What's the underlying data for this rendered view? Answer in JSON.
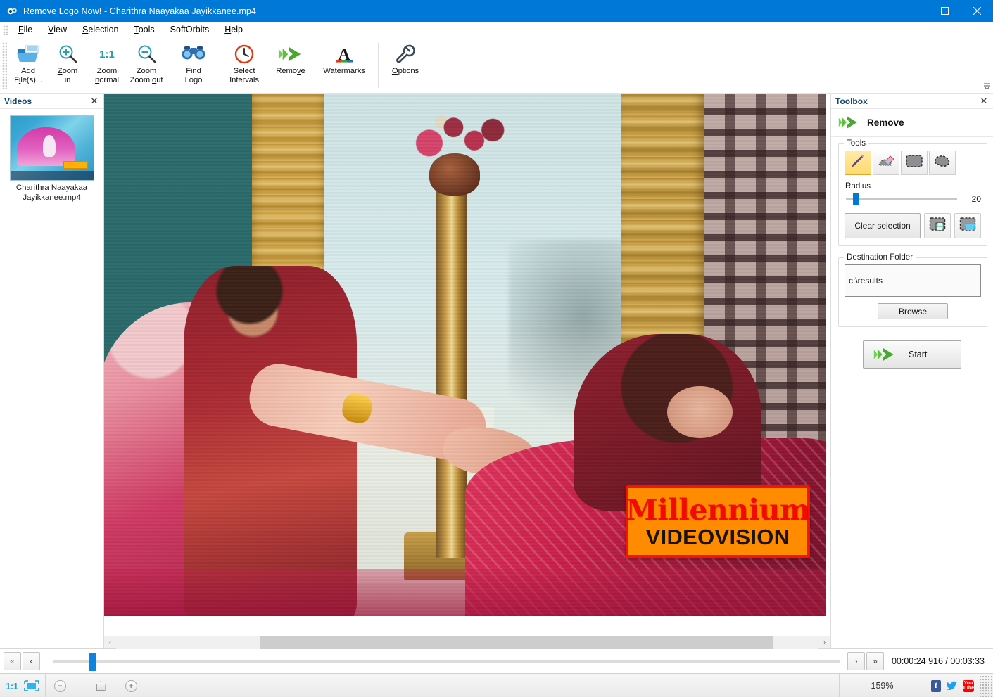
{
  "window": {
    "title": "Remove Logo Now! - Charithra Naayakaa Jayikkanee.mp4",
    "app_icon": "app-logo-icon",
    "minimize": "—",
    "maximize": "☐",
    "close": "✕"
  },
  "menubar": {
    "items": [
      {
        "label": "File",
        "accel": "F"
      },
      {
        "label": "View",
        "accel": "V"
      },
      {
        "label": "Selection",
        "accel": "S"
      },
      {
        "label": "Tools",
        "accel": "T"
      },
      {
        "label": "SoftOrbits",
        "accel": ""
      },
      {
        "label": "Help",
        "accel": "H"
      }
    ]
  },
  "ribbon": {
    "buttons": [
      {
        "name": "add-files",
        "line1": "Add",
        "line2": "File(s)...",
        "icon": "folder-open-icon"
      },
      {
        "name": "zoom-in",
        "line1": "Zoom",
        "line2": "in",
        "icon": "zoom-in-icon"
      },
      {
        "name": "zoom-normal",
        "line1": "Zoom",
        "line2": "normal",
        "icon": "one-to-one-icon"
      },
      {
        "name": "zoom-out",
        "line1": "Zoom",
        "line2": "out",
        "icon": "zoom-out-icon"
      },
      {
        "name": "find-logo",
        "line1": "Find",
        "line2": "Logo",
        "icon": "binoculars-icon"
      },
      {
        "name": "select-intervals",
        "line1": "Select",
        "line2": "Intervals",
        "icon": "clock-icon"
      },
      {
        "name": "remove",
        "line1": "Remove",
        "line2": "",
        "icon": "green-arrow-icon"
      },
      {
        "name": "watermarks",
        "line1": "Watermarks",
        "line2": "",
        "icon": "letter-a-icon"
      },
      {
        "name": "options",
        "line1": "Options",
        "line2": "",
        "icon": "wrench-icon"
      }
    ],
    "expand": "☰"
  },
  "videos_panel": {
    "title": "Videos",
    "close": "✕",
    "items": [
      {
        "label": "Charithra Naayakaa Jayikkanee.mp4",
        "thumbnail": "video-thumbnail"
      }
    ]
  },
  "canvas": {
    "watermark": {
      "line1": "Millennium",
      "line2": "VIDEOVISION",
      "bg_color": "#ff8c00",
      "border_color": "#f41500",
      "line1_color": "#f10b00",
      "line2_color": "#1b1208"
    },
    "hscroll": {
      "left_arrow": "‹",
      "right_arrow": "›"
    }
  },
  "toolbox": {
    "title": "Toolbox",
    "close": "✕",
    "mode_label": "Remove",
    "mode_icon": "green-arrow-icon",
    "tools_group": {
      "legend": "Tools",
      "tools": [
        {
          "name": "pencil-tool",
          "icon": "pencil-icon",
          "selected": true
        },
        {
          "name": "eraser-tool",
          "icon": "eraser-icon",
          "selected": false
        },
        {
          "name": "rectangle-select-tool",
          "icon": "rectangle-select-icon",
          "selected": false
        },
        {
          "name": "lasso-select-tool",
          "icon": "lasso-icon",
          "selected": false
        }
      ],
      "radius_label": "Radius",
      "radius_value": "20",
      "clear_selection_label": "Clear selection",
      "save_selection_icon": "save-selection-icon",
      "load_selection_icon": "load-selection-icon"
    },
    "destination_group": {
      "legend": "Destination Folder",
      "path_value": "c:\\results",
      "browse_label": "Browse"
    },
    "start_label": "Start",
    "start_icon": "green-arrow-icon"
  },
  "transport": {
    "first_label": "«",
    "prev_label": "‹",
    "next_label": "›",
    "last_label": "»",
    "time": "00:00:24 916 / 00:03:33",
    "position_percent": 4.6
  },
  "statusbar": {
    "one_to_one": "1:1",
    "fit_icon": "fit-to-window-icon",
    "zoom_out_icon": "minus-icon",
    "zoom_in_icon": "plus-icon",
    "zoom_level": "159%",
    "social": [
      {
        "name": "facebook-icon",
        "glyph": "f"
      },
      {
        "name": "twitter-icon",
        "glyph": ""
      },
      {
        "name": "youtube-icon",
        "glyph_top": "You",
        "glyph_bottom": "Tube"
      }
    ]
  },
  "colors": {
    "titlebar": "#0078d7",
    "accent": "#0078d7",
    "panel_bg": "#ffffff",
    "chrome_bg": "#f0f0f0",
    "selected_tool": "#ffd96a"
  }
}
